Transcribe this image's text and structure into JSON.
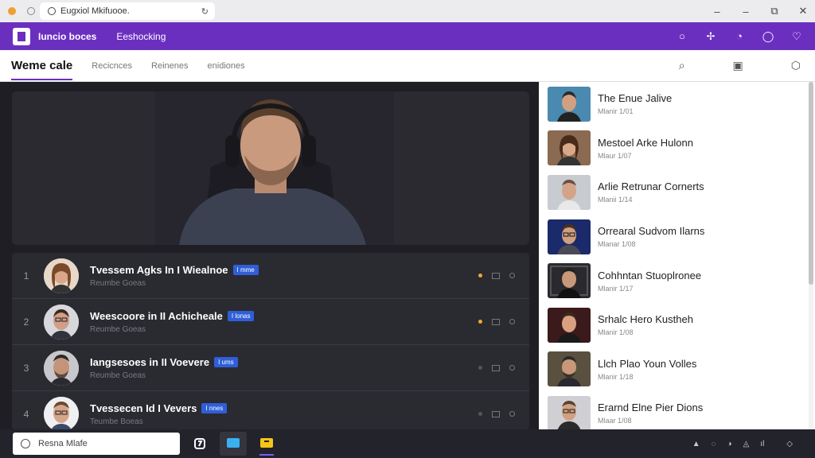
{
  "browser": {
    "url": "Eugxiol Mkifuooe.",
    "reload_icon": "reload-icon",
    "controls": [
      "minimize-icon",
      "restore-icon",
      "share-icon",
      "close-icon"
    ]
  },
  "header": {
    "brand": "Iuncio boces",
    "nav_link": "Eeshocking",
    "icons": [
      "circle-icon",
      "sparkle-icon",
      "chat-icon",
      "bell-icon",
      "heart-icon"
    ]
  },
  "subnav": {
    "active_tab": "Weme cale",
    "tabs": [
      "Recicnces",
      "Reinenes",
      "enidiones"
    ],
    "icons": [
      "search-icon",
      "window-icon",
      "settings-icon"
    ]
  },
  "rows": [
    {
      "num": "1",
      "title": "Tvessem Agks In I Wiealnoe",
      "badge": "I mme",
      "sub": "Reumbe Goeas",
      "dot": "orange"
    },
    {
      "num": "2",
      "title": "Weescoore in II Achicheale",
      "badge": "I lonas",
      "sub": "Reumbe Goeas",
      "dot": "orange"
    },
    {
      "num": "3",
      "title": "Iangsesoes in II Voevere",
      "badge": "I ums",
      "sub": "Reumbe Goeas",
      "dot": "dim"
    },
    {
      "num": "4",
      "title": "Tvessecen Id I Vevers",
      "badge": "I nnes",
      "sub": "Teumbe Boeas",
      "dot": "dim"
    }
  ],
  "sidebar": {
    "items": [
      {
        "name": "The Enue Jalive",
        "sub": "Mlanir 1/01"
      },
      {
        "name": "Mestoel Arke Hulonn",
        "sub": "Mlaur 1/07"
      },
      {
        "name": "Arlie Retrunar Cornerts",
        "sub": "Mlanii 1/14"
      },
      {
        "name": "Orrearal Sudvom Ilarns",
        "sub": "Mlanar 1/08"
      },
      {
        "name": "Cohhntan Stuoplronee",
        "sub": "Mlanir 1/17"
      },
      {
        "name": "Srhalc Hero Kustheh",
        "sub": "Mlanir 1/08"
      },
      {
        "name": "Llch Plao Youn Volles",
        "sub": "Mlanir 1/18"
      },
      {
        "name": "Erarnd Elne Pier Dions",
        "sub": "Mlaar 1/08"
      }
    ]
  },
  "taskbar": {
    "search_text": "Resna Mlafe",
    "tray": [
      "chevron-up-icon",
      "chat-icon",
      "globe-icon",
      "volume-icon",
      "wifi-icon",
      "notification-icon"
    ]
  },
  "colors": {
    "accent": "#6b2fc0",
    "badge": "#2f5fd8",
    "highlight_dot": "#f0a830"
  }
}
